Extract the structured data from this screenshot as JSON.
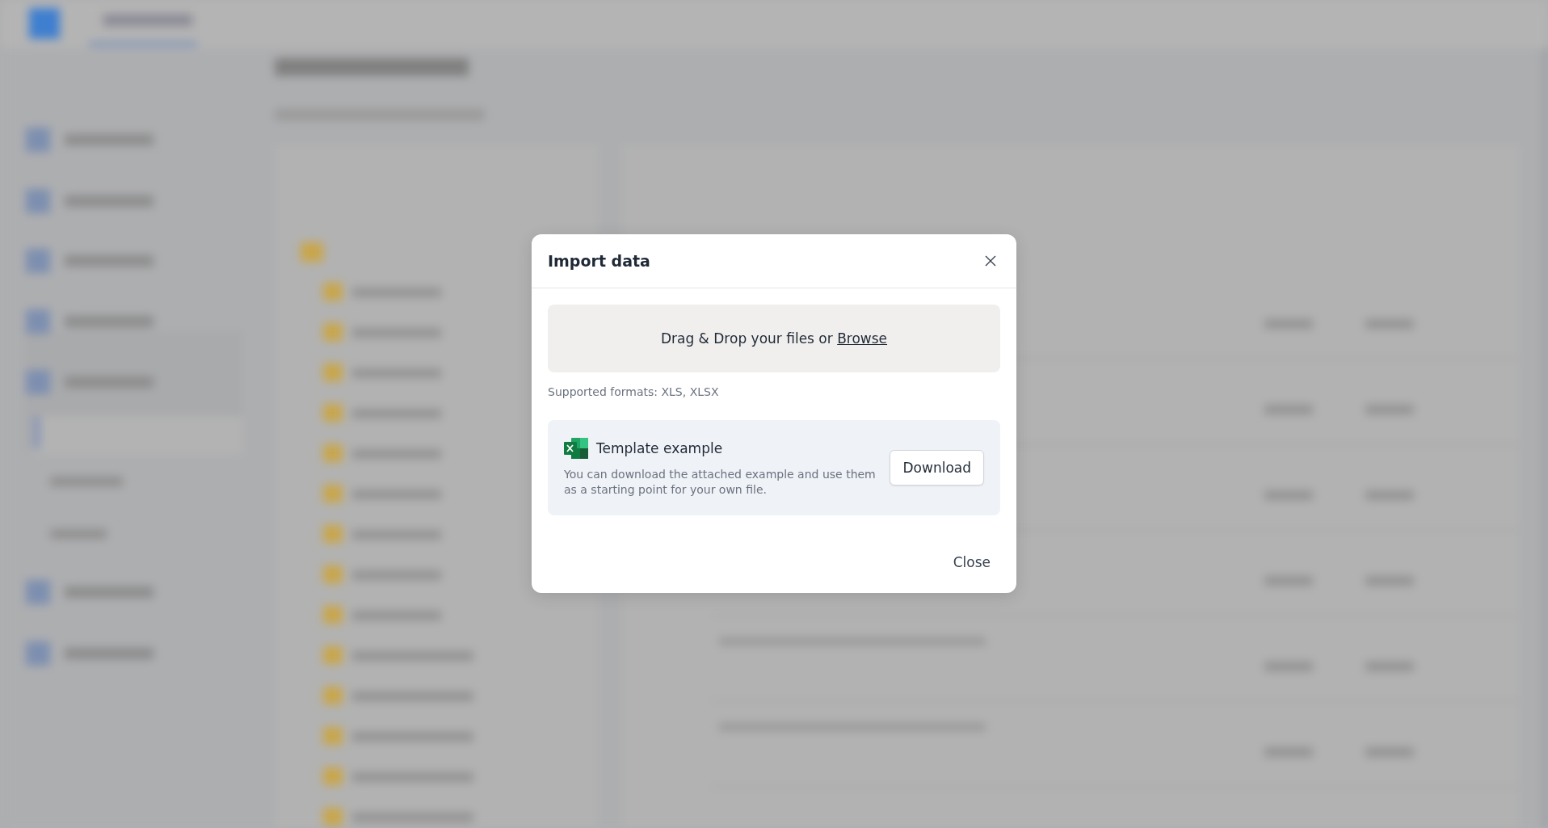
{
  "backdrop": {
    "blurred": true
  },
  "dialog": {
    "title": "Import data",
    "dropzone": {
      "text": "Drag & Drop your files or ",
      "link": "Browse"
    },
    "supported_formats": "Supported formats: XLS, XLSX",
    "template": {
      "title": "Template example",
      "description": "You can download the attached example and use them as a starting point for your own file.",
      "button": "Download"
    },
    "footer_button": "Close"
  }
}
